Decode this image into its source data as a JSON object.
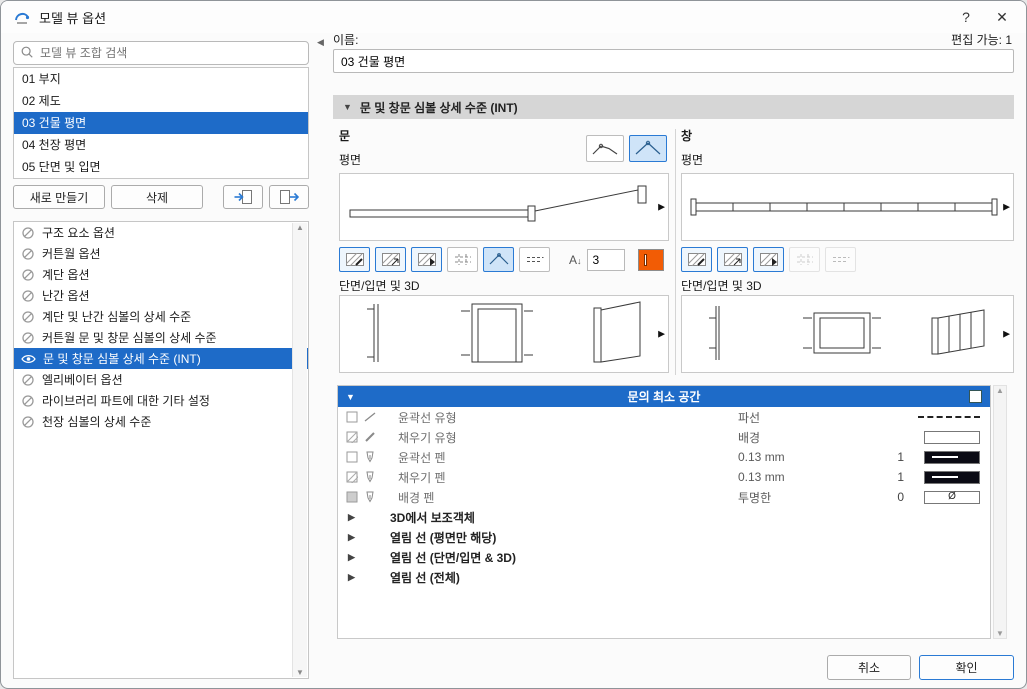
{
  "window": {
    "title": "모델 뷰 옵션",
    "help_label": "?",
    "close_label": "✕"
  },
  "colors": {
    "accent": "#1e6bc8",
    "selection": "#1e6bc8",
    "pen_swatch": "#f25c05",
    "header_gray": "#d6d6d6"
  },
  "left": {
    "search_placeholder": "모델 뷰 조합 검색",
    "combinations": [
      {
        "label": "01 부지",
        "selected": false
      },
      {
        "label": "02 제도",
        "selected": false
      },
      {
        "label": "03 건물 평면",
        "selected": true
      },
      {
        "label": "04 천장 평면",
        "selected": false
      },
      {
        "label": "05 단면 및 입면",
        "selected": false
      }
    ],
    "new_button": "새로 만들기",
    "delete_button": "삭제",
    "options": [
      {
        "label": "구조 요소 옵션",
        "selected": false,
        "icon": "hidden-eye-icon"
      },
      {
        "label": "커튼월 옵션",
        "selected": false,
        "icon": "hidden-eye-icon"
      },
      {
        "label": "계단 옵션",
        "selected": false,
        "icon": "hidden-eye-icon"
      },
      {
        "label": "난간 옵션",
        "selected": false,
        "icon": "hidden-eye-icon"
      },
      {
        "label": "계단 및 난간 심볼의 상세 수준",
        "selected": false,
        "icon": "hidden-eye-icon"
      },
      {
        "label": "커튼월 문 및 창문 심볼의 상세 수준",
        "selected": false,
        "icon": "hidden-eye-icon"
      },
      {
        "label": "문 및 창문 심볼 상세 수준 (INT)",
        "selected": true,
        "icon": "eye-icon"
      },
      {
        "label": "엘리베이터 옵션",
        "selected": false,
        "icon": "hidden-eye-icon"
      },
      {
        "label": "라이브러리 파트에 대한 기타 설정",
        "selected": false,
        "icon": "hidden-eye-icon"
      },
      {
        "label": "천장 심볼의 상세 수준",
        "selected": false,
        "icon": "hidden-eye-icon"
      }
    ]
  },
  "right": {
    "name_label": "이름:",
    "editable_count": "편집 가능: 1",
    "name_value": "03 건물 평면",
    "section_title": "문 및 창문 심볼 상세 수준 (INT)",
    "door": {
      "title": "문",
      "plan_label": "평면",
      "section3d_label": "단면/입면 및 3D",
      "text_size_value": "3"
    },
    "window_column": {
      "title": "창",
      "plan_label": "평면",
      "section3d_label": "단면/입면 및 3D"
    },
    "table": {
      "header": "문의 최소 공간",
      "rows": [
        {
          "label": "윤곽선 유형",
          "value": "파선",
          "pen": ""
        },
        {
          "label": "채우기 유형",
          "value": "배경",
          "pen": ""
        },
        {
          "label": "윤곽선 펜",
          "value": "0.13 mm",
          "pen": "1"
        },
        {
          "label": "채우기 펜",
          "value": "0.13 mm",
          "pen": "1"
        },
        {
          "label": "배경 펜",
          "value": "투명한",
          "pen": "0",
          "preview_symbol": "Ø"
        }
      ],
      "groups": [
        {
          "label": "3D에서 보조객체"
        },
        {
          "label": "열림 선 (평면만 해당)"
        },
        {
          "label": "열림 선 (단면/입면 & 3D)"
        },
        {
          "label": "열림 선 (전체)"
        }
      ]
    },
    "cancel_button": "취소",
    "ok_button": "확인"
  }
}
